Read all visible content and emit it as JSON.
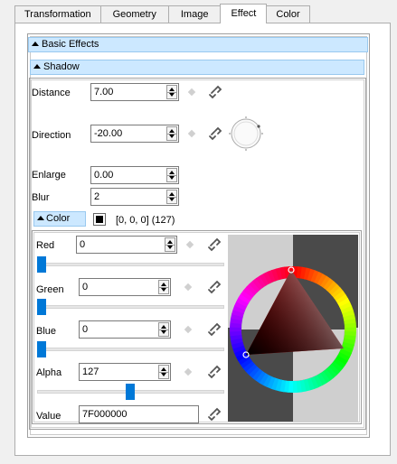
{
  "tabs": [
    {
      "label": "Transformation"
    },
    {
      "label": "Geometry"
    },
    {
      "label": "Image"
    },
    {
      "label": "Effect"
    },
    {
      "label": "Color"
    }
  ],
  "active_tab": "Effect",
  "basic_effects": {
    "label": "Basic Effects"
  },
  "shadow": {
    "label": "Shadow",
    "distance": {
      "label": "Distance",
      "value": "7.00"
    },
    "direction": {
      "label": "Direction",
      "value": "-20.00"
    },
    "enlarge": {
      "label": "Enlarge",
      "value": "0.00"
    },
    "blur": {
      "label": "Blur",
      "value": "2"
    }
  },
  "color": {
    "label": "Color",
    "summary": "[0, 0, 0] (127)",
    "swatch_color": "#000000",
    "red": {
      "label": "Red",
      "value": "0",
      "level": 0
    },
    "green": {
      "label": "Green",
      "value": "0",
      "level": 0
    },
    "blue": {
      "label": "Blue",
      "value": "0",
      "level": 0
    },
    "alpha": {
      "label": "Alpha",
      "value": "127",
      "level": 0.498
    },
    "hex": {
      "label": "Value",
      "value": "7F000000"
    }
  },
  "colors": {
    "header_bg": "#cce8ff",
    "header_border": "#99c9ef",
    "slider_thumb": "#0078d7"
  },
  "icons": [
    "link-icon",
    "reset-diamond-icon",
    "direction-dial-icon",
    "color-wheel"
  ]
}
